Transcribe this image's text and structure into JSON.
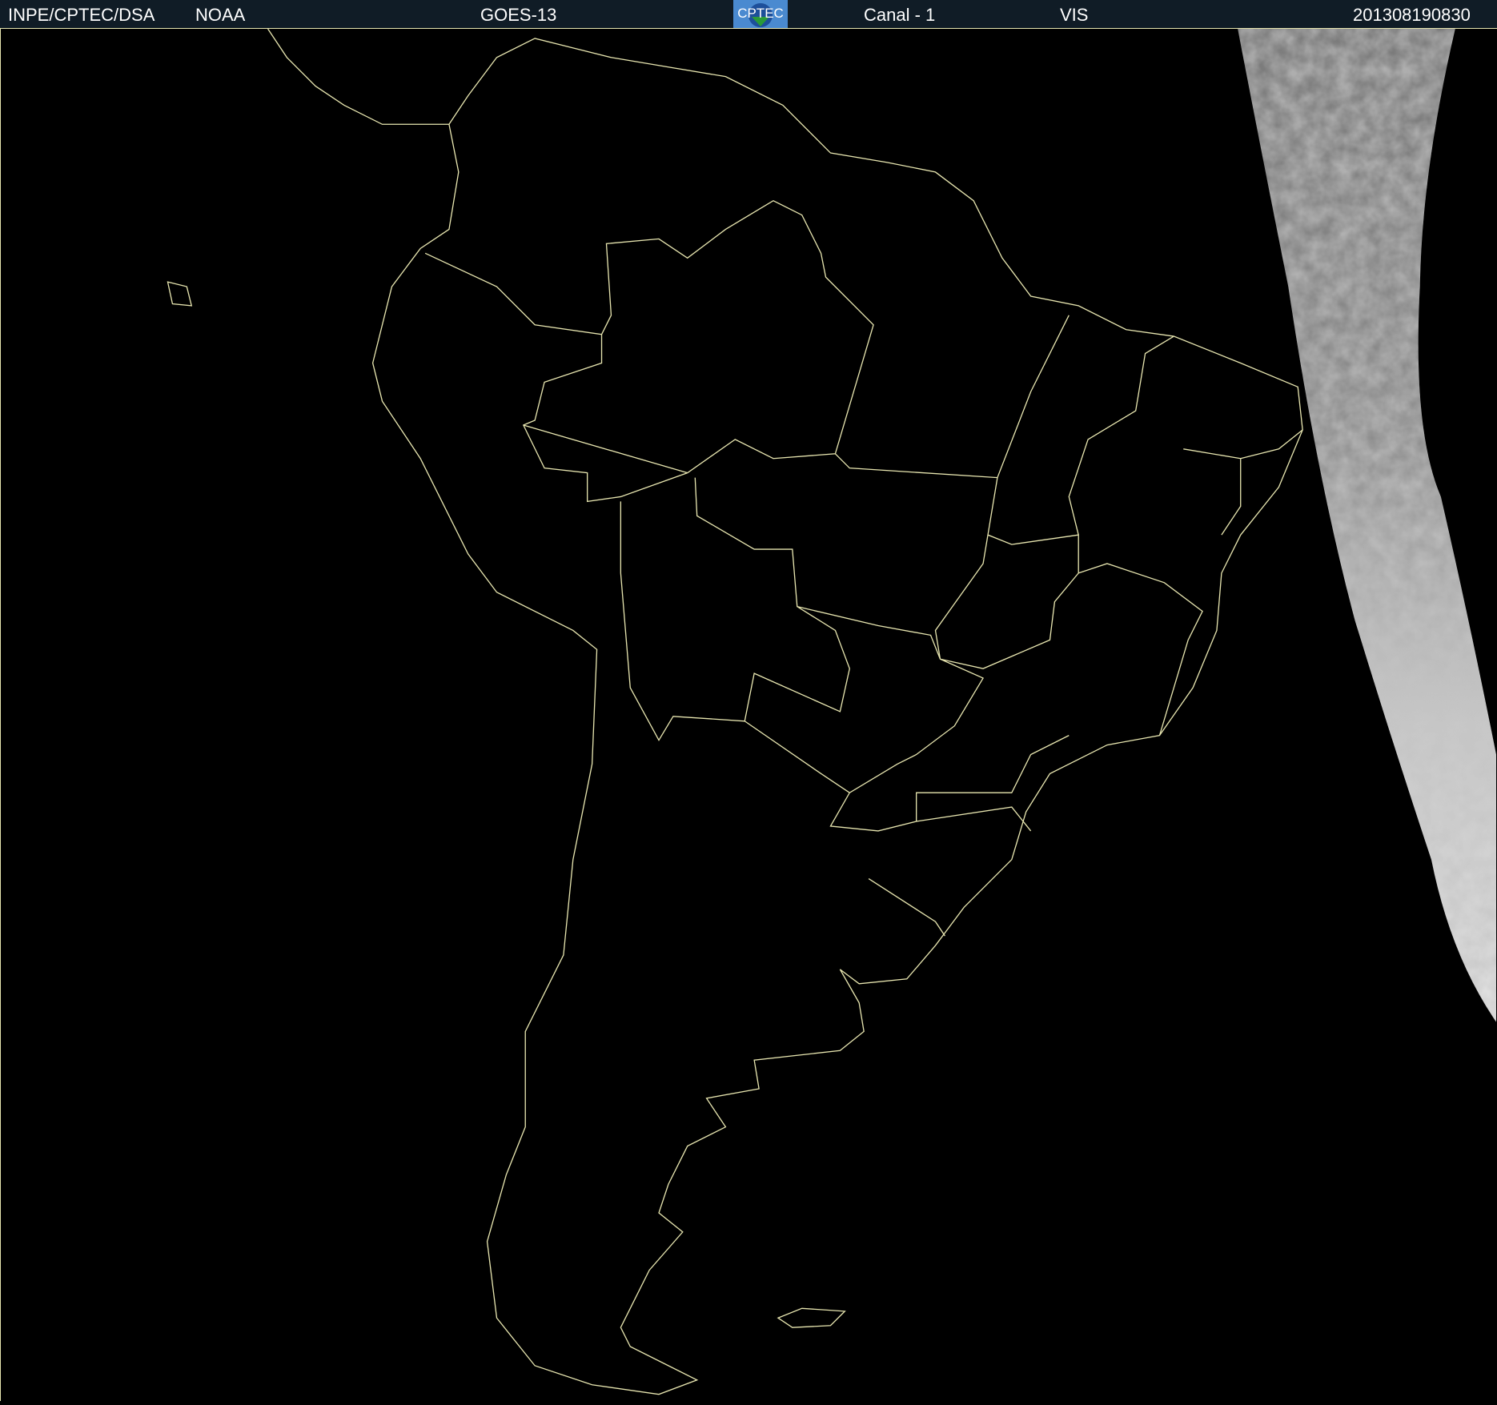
{
  "header": {
    "institution": "INPE/CPTEC/DSA",
    "agency": "NOAA",
    "satellite": "GOES-13",
    "logo_text": "CPTEC",
    "channel": "Canal - 1",
    "band": "VIS",
    "timestamp": "201308190830"
  },
  "colors": {
    "header_bg": "#101c26",
    "coastline": "#e8e6b0",
    "background": "#000000"
  }
}
